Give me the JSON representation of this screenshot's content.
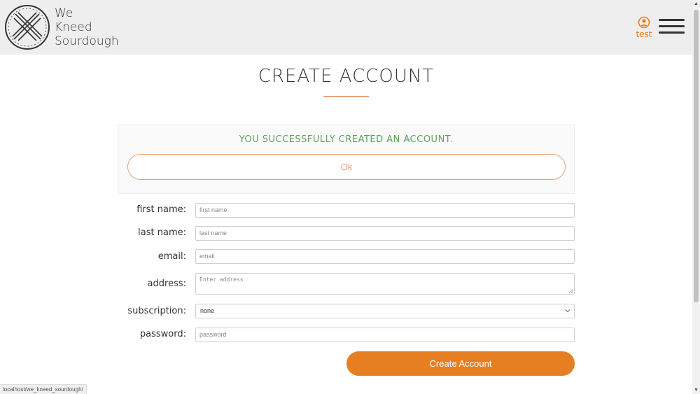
{
  "header": {
    "brand_lines": [
      "We",
      "Kneed",
      "Sourdough"
    ],
    "user_label": "test",
    "logo_icon": "crossed-whisks-logo-icon",
    "user_icon": "user-circle-icon",
    "menu_icon": "hamburger-menu-icon"
  },
  "page": {
    "title": "CREATE ACCOUNT"
  },
  "alert": {
    "message": "YOU SUCCESSFULLY CREATED AN ACCOUNT.",
    "ok_label": "Ok"
  },
  "form": {
    "first_name": {
      "label": "first name:",
      "placeholder": "first name",
      "value": ""
    },
    "last_name": {
      "label": "last name:",
      "placeholder": "last name",
      "value": ""
    },
    "email": {
      "label": "email:",
      "placeholder": "email",
      "value": ""
    },
    "address": {
      "label": "address:",
      "placeholder": "Enter address",
      "value": ""
    },
    "subscription": {
      "label": "subscription:",
      "selected": "none"
    },
    "password": {
      "label": "password:",
      "placeholder": "password",
      "value": ""
    },
    "submit_label": "Create Account"
  },
  "status_bar": {
    "url": "localhost/we_kneed_sourdough/"
  },
  "colors": {
    "accent": "#e67e22",
    "accent_light": "#e8a27a",
    "success": "#5fa05f",
    "header_bg": "#eeeeee"
  }
}
